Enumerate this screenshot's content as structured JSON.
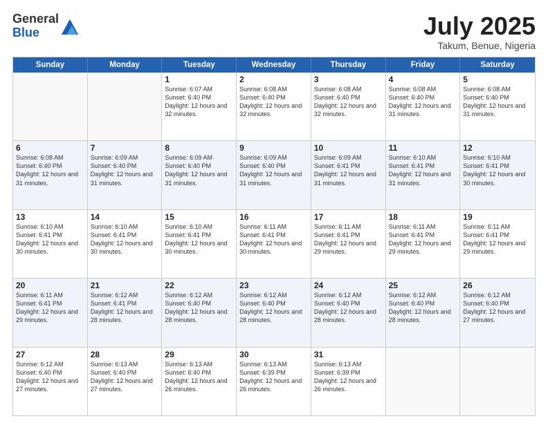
{
  "logo": {
    "general": "General",
    "blue": "Blue"
  },
  "header": {
    "title": "July 2025",
    "subtitle": "Takum, Benue, Nigeria"
  },
  "weekdays": [
    "Sunday",
    "Monday",
    "Tuesday",
    "Wednesday",
    "Thursday",
    "Friday",
    "Saturday"
  ],
  "rows": [
    [
      {
        "day": "",
        "sunrise": "",
        "sunset": "",
        "daylight": "",
        "empty": true
      },
      {
        "day": "",
        "sunrise": "",
        "sunset": "",
        "daylight": "",
        "empty": true
      },
      {
        "day": "1",
        "sunrise": "Sunrise: 6:07 AM",
        "sunset": "Sunset: 6:40 PM",
        "daylight": "Daylight: 12 hours and 32 minutes.",
        "empty": false
      },
      {
        "day": "2",
        "sunrise": "Sunrise: 6:08 AM",
        "sunset": "Sunset: 6:40 PM",
        "daylight": "Daylight: 12 hours and 32 minutes.",
        "empty": false
      },
      {
        "day": "3",
        "sunrise": "Sunrise: 6:08 AM",
        "sunset": "Sunset: 6:40 PM",
        "daylight": "Daylight: 12 hours and 32 minutes.",
        "empty": false
      },
      {
        "day": "4",
        "sunrise": "Sunrise: 6:08 AM",
        "sunset": "Sunset: 6:40 PM",
        "daylight": "Daylight: 12 hours and 31 minutes.",
        "empty": false
      },
      {
        "day": "5",
        "sunrise": "Sunrise: 6:08 AM",
        "sunset": "Sunset: 6:40 PM",
        "daylight": "Daylight: 12 hours and 31 minutes.",
        "empty": false
      }
    ],
    [
      {
        "day": "6",
        "sunrise": "Sunrise: 6:08 AM",
        "sunset": "Sunset: 6:40 PM",
        "daylight": "Daylight: 12 hours and 31 minutes.",
        "empty": false
      },
      {
        "day": "7",
        "sunrise": "Sunrise: 6:09 AM",
        "sunset": "Sunset: 6:40 PM",
        "daylight": "Daylight: 12 hours and 31 minutes.",
        "empty": false
      },
      {
        "day": "8",
        "sunrise": "Sunrise: 6:09 AM",
        "sunset": "Sunset: 6:40 PM",
        "daylight": "Daylight: 12 hours and 31 minutes.",
        "empty": false
      },
      {
        "day": "9",
        "sunrise": "Sunrise: 6:09 AM",
        "sunset": "Sunset: 6:40 PM",
        "daylight": "Daylight: 12 hours and 31 minutes.",
        "empty": false
      },
      {
        "day": "10",
        "sunrise": "Sunrise: 6:09 AM",
        "sunset": "Sunset: 6:41 PM",
        "daylight": "Daylight: 12 hours and 31 minutes.",
        "empty": false
      },
      {
        "day": "11",
        "sunrise": "Sunrise: 6:10 AM",
        "sunset": "Sunset: 6:41 PM",
        "daylight": "Daylight: 12 hours and 31 minutes.",
        "empty": false
      },
      {
        "day": "12",
        "sunrise": "Sunrise: 6:10 AM",
        "sunset": "Sunset: 6:41 PM",
        "daylight": "Daylight: 12 hours and 30 minutes.",
        "empty": false
      }
    ],
    [
      {
        "day": "13",
        "sunrise": "Sunrise: 6:10 AM",
        "sunset": "Sunset: 6:41 PM",
        "daylight": "Daylight: 12 hours and 30 minutes.",
        "empty": false
      },
      {
        "day": "14",
        "sunrise": "Sunrise: 6:10 AM",
        "sunset": "Sunset: 6:41 PM",
        "daylight": "Daylight: 12 hours and 30 minutes.",
        "empty": false
      },
      {
        "day": "15",
        "sunrise": "Sunrise: 6:10 AM",
        "sunset": "Sunset: 6:41 PM",
        "daylight": "Daylight: 12 hours and 30 minutes.",
        "empty": false
      },
      {
        "day": "16",
        "sunrise": "Sunrise: 6:11 AM",
        "sunset": "Sunset: 6:41 PM",
        "daylight": "Daylight: 12 hours and 30 minutes.",
        "empty": false
      },
      {
        "day": "17",
        "sunrise": "Sunrise: 6:11 AM",
        "sunset": "Sunset: 6:41 PM",
        "daylight": "Daylight: 12 hours and 29 minutes.",
        "empty": false
      },
      {
        "day": "18",
        "sunrise": "Sunrise: 6:11 AM",
        "sunset": "Sunset: 6:41 PM",
        "daylight": "Daylight: 12 hours and 29 minutes.",
        "empty": false
      },
      {
        "day": "19",
        "sunrise": "Sunrise: 6:11 AM",
        "sunset": "Sunset: 6:41 PM",
        "daylight": "Daylight: 12 hours and 29 minutes.",
        "empty": false
      }
    ],
    [
      {
        "day": "20",
        "sunrise": "Sunrise: 6:11 AM",
        "sunset": "Sunset: 6:41 PM",
        "daylight": "Daylight: 12 hours and 29 minutes.",
        "empty": false
      },
      {
        "day": "21",
        "sunrise": "Sunrise: 6:12 AM",
        "sunset": "Sunset: 6:41 PM",
        "daylight": "Daylight: 12 hours and 28 minutes.",
        "empty": false
      },
      {
        "day": "22",
        "sunrise": "Sunrise: 6:12 AM",
        "sunset": "Sunset: 6:40 PM",
        "daylight": "Daylight: 12 hours and 28 minutes.",
        "empty": false
      },
      {
        "day": "23",
        "sunrise": "Sunrise: 6:12 AM",
        "sunset": "Sunset: 6:40 PM",
        "daylight": "Daylight: 12 hours and 28 minutes.",
        "empty": false
      },
      {
        "day": "24",
        "sunrise": "Sunrise: 6:12 AM",
        "sunset": "Sunset: 6:40 PM",
        "daylight": "Daylight: 12 hours and 28 minutes.",
        "empty": false
      },
      {
        "day": "25",
        "sunrise": "Sunrise: 6:12 AM",
        "sunset": "Sunset: 6:40 PM",
        "daylight": "Daylight: 12 hours and 28 minutes.",
        "empty": false
      },
      {
        "day": "26",
        "sunrise": "Sunrise: 6:12 AM",
        "sunset": "Sunset: 6:40 PM",
        "daylight": "Daylight: 12 hours and 27 minutes.",
        "empty": false
      }
    ],
    [
      {
        "day": "27",
        "sunrise": "Sunrise: 6:12 AM",
        "sunset": "Sunset: 6:40 PM",
        "daylight": "Daylight: 12 hours and 27 minutes.",
        "empty": false
      },
      {
        "day": "28",
        "sunrise": "Sunrise: 6:13 AM",
        "sunset": "Sunset: 6:40 PM",
        "daylight": "Daylight: 12 hours and 27 minutes.",
        "empty": false
      },
      {
        "day": "29",
        "sunrise": "Sunrise: 6:13 AM",
        "sunset": "Sunset: 6:40 PM",
        "daylight": "Daylight: 12 hours and 26 minutes.",
        "empty": false
      },
      {
        "day": "30",
        "sunrise": "Sunrise: 6:13 AM",
        "sunset": "Sunset: 6:39 PM",
        "daylight": "Daylight: 12 hours and 26 minutes.",
        "empty": false
      },
      {
        "day": "31",
        "sunrise": "Sunrise: 6:13 AM",
        "sunset": "Sunset: 6:39 PM",
        "daylight": "Daylight: 12 hours and 26 minutes.",
        "empty": false
      },
      {
        "day": "",
        "sunrise": "",
        "sunset": "",
        "daylight": "",
        "empty": true
      },
      {
        "day": "",
        "sunrise": "",
        "sunset": "",
        "daylight": "",
        "empty": true
      }
    ]
  ]
}
